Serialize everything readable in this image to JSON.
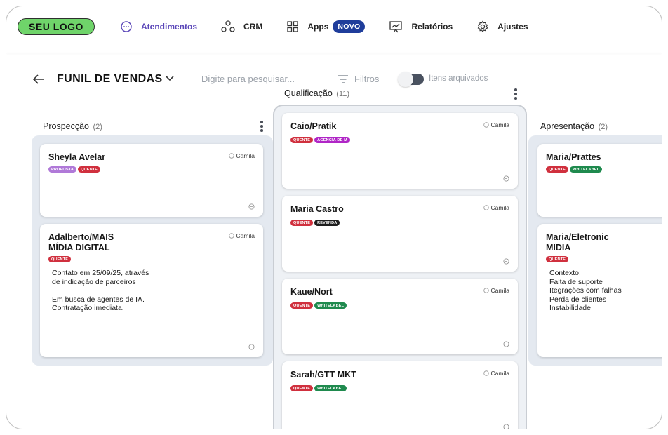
{
  "nav": {
    "logo": "SEU LOGO",
    "items": [
      {
        "label": "Atendimentos",
        "icon": "chat-icon",
        "active": true
      },
      {
        "label": "CRM",
        "icon": "crm-nodes-icon"
      },
      {
        "label": "Apps",
        "icon": "apps-grid-icon",
        "badge": "NOVO"
      },
      {
        "label": "Relatórios",
        "icon": "chart-icon"
      },
      {
        "label": "Ajustes",
        "icon": "gear-icon"
      }
    ]
  },
  "toolbar": {
    "title": "FUNIL DE VENDAS",
    "search_placeholder": "Digite para pesquisar...",
    "filters_label": "Filtros",
    "archived_label": "Itens arquivados"
  },
  "columns": [
    {
      "title": "Prospecção",
      "count": "(2)",
      "cards": [
        {
          "name": "Sheyla Avelar",
          "owner": "Camila",
          "tags": [
            {
              "label": "PROPOSTA",
              "color": "#b079d8"
            },
            {
              "label": "QUENTE",
              "color": "#d0303e"
            }
          ]
        },
        {
          "name": "Adalberto/MAIS\nMÍDIA DIGITAL",
          "owner": "Camila",
          "tags": [
            {
              "label": "QUENTE",
              "color": "#d0303e"
            }
          ],
          "description": "Contato em 25/09/25, através\nde indicação de parceiros\n\nEm busca de agentes de IA.\nContratação imediata."
        }
      ]
    },
    {
      "title": "Qualificação",
      "count": "(11)",
      "cards": [
        {
          "name": "Caio/Pratik",
          "owner": "Camila",
          "tags": [
            {
              "label": "QUENTE",
              "color": "#d0303e"
            },
            {
              "label": "AGÊNCIA DE M",
              "color": "#b026c6"
            }
          ]
        },
        {
          "name": "Maria Castro",
          "owner": "Camila",
          "tags": [
            {
              "label": "QUENTE",
              "color": "#d0303e"
            },
            {
              "label": "REVENDA",
              "color": "#1e1e1e"
            }
          ]
        },
        {
          "name": "Kaue/Nort",
          "owner": "Camila",
          "tags": [
            {
              "label": "QUENTE",
              "color": "#d0303e"
            },
            {
              "label": "WHITELABEL",
              "color": "#1f8a4e"
            }
          ]
        },
        {
          "name": "Sarah/GTT MKT",
          "owner": "Camila",
          "tags": [
            {
              "label": "QUENTE",
              "color": "#d0303e"
            },
            {
              "label": "WHITELABEL",
              "color": "#1f8a4e"
            }
          ]
        }
      ]
    },
    {
      "title": "Apresentação",
      "count": "(2)",
      "cards": [
        {
          "name": "Maria/Prattes",
          "owner": "",
          "tags": [
            {
              "label": "QUENTE",
              "color": "#d0303e"
            },
            {
              "label": "WHITELABEL",
              "color": "#1f8a4e"
            }
          ]
        },
        {
          "name": "Maria/Eletronic\nMIDIA",
          "owner": "",
          "tags": [
            {
              "label": "QUENTE",
              "color": "#d0303e"
            }
          ],
          "description": "Contexto:\nFalta de suporte\nItegrações com falhas\nPerda de clientes\nInstabilidade"
        }
      ]
    }
  ]
}
